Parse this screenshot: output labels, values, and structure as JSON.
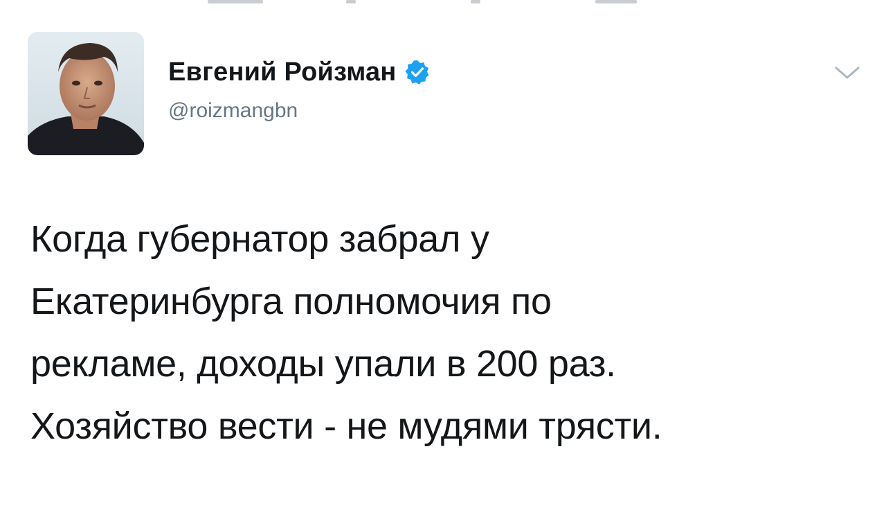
{
  "author": {
    "display_name": "Евгений Ройзман",
    "handle": "@roizmangbn",
    "verified": true,
    "avatar_icon": "user-photo-avatar"
  },
  "menu": {
    "icon": "chevron-down-icon"
  },
  "tweet": {
    "lines": [
      "Когда губернатор забрал у",
      "Екатеринбурга полномочия по",
      "рекламе, доходы упали в 200 раз.",
      "Хозяйство вести - не мудями трясти."
    ]
  },
  "colors": {
    "text_primary": "#14171a",
    "text_secondary": "#657786",
    "verified_badge": "#1da1f2",
    "background": "#ffffff"
  }
}
